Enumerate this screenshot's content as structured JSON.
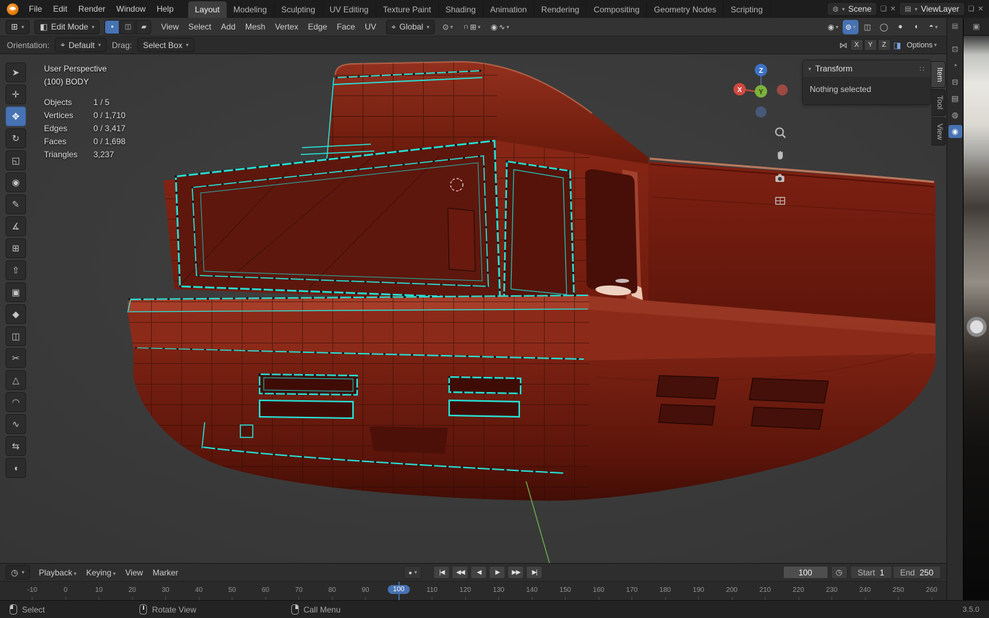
{
  "topbar": {
    "menus": [
      "File",
      "Edit",
      "Render",
      "Window",
      "Help"
    ],
    "workspaces": [
      "Layout",
      "Modeling",
      "Sculpting",
      "UV Editing",
      "Texture Paint",
      "Shading",
      "Animation",
      "Rendering",
      "Compositing",
      "Geometry Nodes",
      "Scripting"
    ],
    "active_workspace": "Layout",
    "scene_label": "Scene",
    "viewlayer_label": "ViewLayer"
  },
  "vp_header": {
    "mode_label": "Edit Mode",
    "select_modes": [
      "▪",
      "◫",
      "▰"
    ],
    "active_select_mode": 0,
    "menus": [
      "View",
      "Select",
      "Add",
      "Mesh",
      "Vertex",
      "Edge",
      "Face",
      "UV"
    ],
    "orientation_label": "Global",
    "right_icons": [
      {
        "name": "show-gizmo",
        "glyph": "◉",
        "chevron": true,
        "active": false
      },
      {
        "name": "show-overlays",
        "glyph": "⊚",
        "chevron": true,
        "active": true
      },
      {
        "name": "toggle-xray",
        "glyph": "◫",
        "chevron": false,
        "active": false
      },
      {
        "name": "shading-wireframe",
        "glyph": "◯",
        "chevron": false,
        "active": false
      },
      {
        "name": "shading-solid",
        "glyph": "●",
        "chevron": false,
        "active": false
      },
      {
        "name": "shading-material",
        "glyph": "◐",
        "chevron": false,
        "active": false
      },
      {
        "name": "shading-rendered",
        "glyph": "◓",
        "chevron": true,
        "active": false
      }
    ]
  },
  "tool_row": {
    "orientation_label": "Orientation:",
    "orientation_value": "Default",
    "drag_label": "Drag:",
    "drag_value": "Select Box",
    "axes": [
      "X",
      "Y",
      "Z"
    ],
    "options_label": "Options"
  },
  "toolbar": {
    "tools": [
      {
        "name": "tweak",
        "glyph": "➤",
        "active": false
      },
      {
        "name": "cursor",
        "glyph": "✛",
        "active": false
      },
      {
        "name": "move",
        "glyph": "✥",
        "active": true
      },
      {
        "name": "rotate",
        "glyph": "↻",
        "active": false
      },
      {
        "name": "scale",
        "glyph": "◱",
        "active": false
      },
      {
        "name": "transform",
        "glyph": "◉",
        "active": false
      },
      {
        "name": "annotate",
        "glyph": "✎",
        "active": false
      },
      {
        "name": "measure",
        "glyph": "∡",
        "active": false
      },
      {
        "name": "add-cube",
        "glyph": "⊞",
        "active": false
      },
      {
        "name": "extrude-region",
        "glyph": "⇧",
        "active": false
      },
      {
        "name": "inset-faces",
        "glyph": "▣",
        "active": false
      },
      {
        "name": "bevel",
        "glyph": "◆",
        "active": false
      },
      {
        "name": "loop-cut",
        "glyph": "◫",
        "active": false
      },
      {
        "name": "knife",
        "glyph": "✂",
        "active": false
      },
      {
        "name": "poly-build",
        "glyph": "△",
        "active": false
      },
      {
        "name": "spin",
        "glyph": "◠",
        "active": false
      },
      {
        "name": "smooth",
        "glyph": "∿",
        "active": false
      },
      {
        "name": "edge-slide",
        "glyph": "⇆",
        "active": false
      },
      {
        "name": "shrink-fatten",
        "glyph": "◖",
        "active": false
      }
    ]
  },
  "overlay": {
    "perspective": "User Perspective",
    "collection": "(100) BODY",
    "stats": [
      [
        "Objects",
        "1 / 5"
      ],
      [
        "Vertices",
        "0 / 1,710"
      ],
      [
        "Edges",
        "0 / 3,417"
      ],
      [
        "Faces",
        "0 / 1,698"
      ],
      [
        "Triangles",
        "3,237"
      ]
    ]
  },
  "gizmo": {
    "x": "X",
    "y": "Y",
    "z": "Z"
  },
  "npanel": {
    "title": "Transform",
    "body": "Nothing selected",
    "tabs": [
      {
        "label": "Item",
        "active": true
      },
      {
        "label": "Tool",
        "active": false
      },
      {
        "label": "View",
        "active": false
      }
    ]
  },
  "timeline": {
    "menus": [
      "Playback",
      "Keying",
      "View",
      "Marker"
    ],
    "menu_chevrons": [
      true,
      true,
      false,
      false
    ],
    "transport": [
      {
        "name": "jump-to-start",
        "glyph": "|◀"
      },
      {
        "name": "previous-keyframe",
        "glyph": "◀◀"
      },
      {
        "name": "play-reverse",
        "glyph": "◀"
      },
      {
        "name": "play",
        "glyph": "▶"
      },
      {
        "name": "next-keyframe",
        "glyph": "▶▶"
      },
      {
        "name": "jump-to-end",
        "glyph": "▶|"
      }
    ],
    "frame_value": "100",
    "start_label": "Start",
    "start_value": "1",
    "end_label": "End",
    "end_value": "250"
  },
  "ruler": {
    "ticks": [
      "-10",
      "0",
      "10",
      "20",
      "30",
      "40",
      "50",
      "60",
      "70",
      "80",
      "90",
      "100",
      "110",
      "120",
      "130",
      "140",
      "150",
      "160",
      "170",
      "180",
      "190",
      "200",
      "210",
      "220",
      "230",
      "240",
      "250",
      "260"
    ],
    "current": "100"
  },
  "props_tabs": [
    {
      "name": "tool",
      "glyph": "⊡",
      "active": false
    },
    {
      "name": "render",
      "glyph": "◔",
      "active": false
    },
    {
      "name": "output",
      "glyph": "⊟",
      "active": false
    },
    {
      "name": "view-layer",
      "glyph": "▤",
      "active": false
    },
    {
      "name": "scene",
      "glyph": "◍",
      "active": false
    },
    {
      "name": "world",
      "glyph": "◉",
      "active": true
    }
  ],
  "status": {
    "hints": [
      {
        "button": "lmb",
        "label": "Select"
      },
      {
        "button": "mmb",
        "label": "Rotate View"
      },
      {
        "button": "rmb",
        "label": "Call Menu"
      }
    ],
    "version": "3.5.0"
  },
  "icons": {
    "chevron": "▾",
    "grid": "⊞",
    "edit_cube": "◧",
    "target": "⌖",
    "pivot": "⊙",
    "magnet": "∩",
    "snap_to": "⊞",
    "prop_circle": "◉",
    "falloff": "∿",
    "mirror": "⋈",
    "snap_blue": "◨",
    "clock": "◷",
    "record": "●",
    "scene": "◍",
    "viewlayer": "▤",
    "copy": "❏",
    "close": "✕",
    "props": "▤",
    "image": "▣",
    "grip": "∷"
  },
  "colors": {
    "accent": "#4772b3",
    "edge_select": "#25e4d9",
    "body_red": "#8a2718"
  }
}
